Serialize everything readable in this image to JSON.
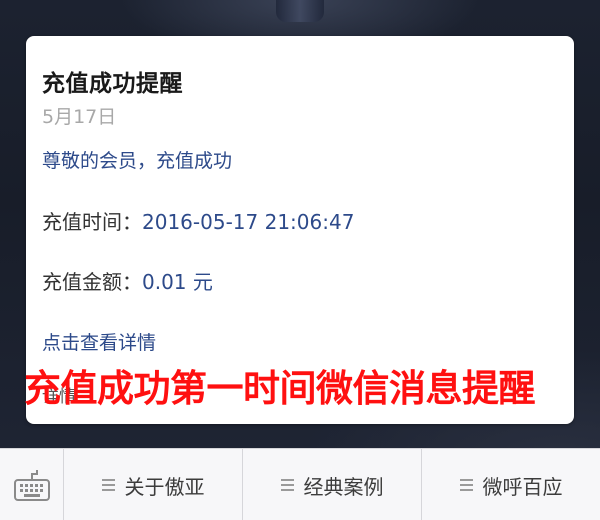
{
  "notification": {
    "title": "充值成功提醒",
    "date": "5月17日",
    "greeting": "尊敬的会员，充值成功",
    "recharge_time_label": "充值时间：",
    "recharge_time_value": "2016-05-17 21:06:47",
    "amount_label": "充值金额：",
    "amount_value": "0.01 元",
    "details_link": "点击查看详情",
    "details_ghost": "详情"
  },
  "overlay_caption": "充值成功第一时间微信消息提醒",
  "menu": {
    "keyboard_icon": "keyboard-icon",
    "items": [
      {
        "label": "关于傲亚",
        "icon": "menu-lines-icon"
      },
      {
        "label": "经典案例",
        "icon": "menu-lines-icon"
      },
      {
        "label": "微呼百应",
        "icon": "menu-lines-icon"
      }
    ]
  },
  "colors": {
    "link_blue": "#2d4a8a",
    "caption_red": "#ff1010",
    "date_gray": "#a8a8a8",
    "background_dark": "#1c2230"
  }
}
